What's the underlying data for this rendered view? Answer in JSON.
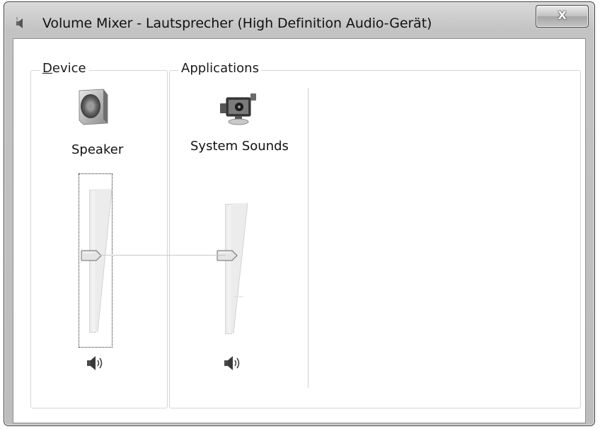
{
  "window": {
    "title": "Volume Mixer - Lautsprecher (High Definition Audio-Gerät)",
    "close_label": "X"
  },
  "device": {
    "group_label_mnemonic": "D",
    "group_label_rest": "evice",
    "channel_name": "Speaker",
    "icon": "speaker-device-icon",
    "volume_fraction": 0.5,
    "mute_icon": "speaker-volume-icon"
  },
  "applications": {
    "group_label": "Applications",
    "channels": [
      {
        "name": "System Sounds",
        "icon": "system-sounds-icon",
        "volume_fraction": 0.5,
        "mute_icon": "speaker-volume-icon"
      }
    ]
  }
}
